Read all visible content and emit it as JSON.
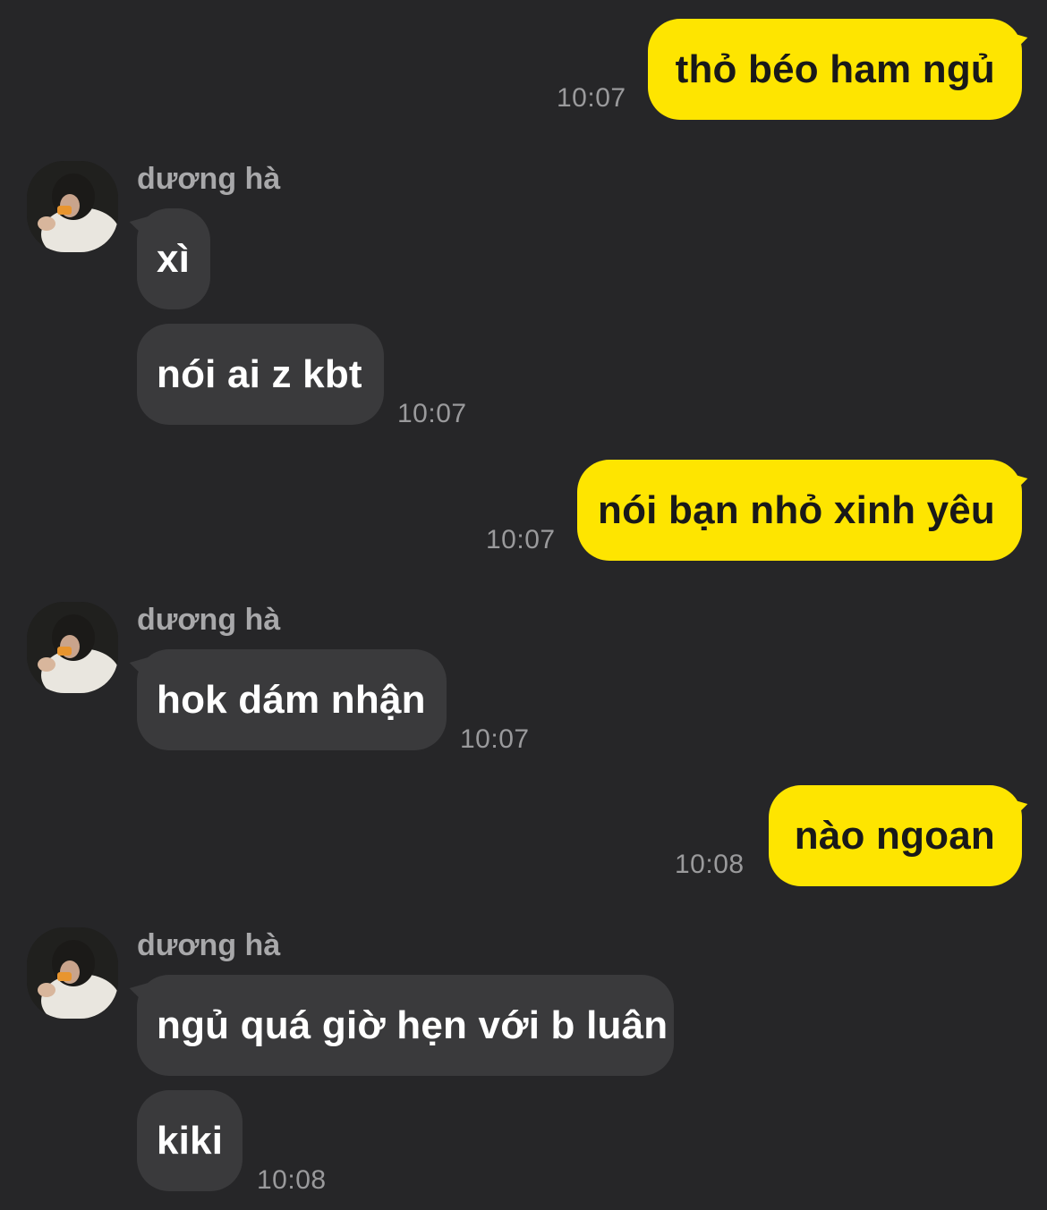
{
  "chat": {
    "contact_name": "dương hà",
    "messages": [
      {
        "dir": "out",
        "text": "thỏ béo ham ngủ",
        "time": "10:07"
      },
      {
        "dir": "in",
        "text": "xì"
      },
      {
        "dir": "in",
        "text": "nói ai z kbt",
        "time": "10:07"
      },
      {
        "dir": "out",
        "text": "nói bạn nhỏ xinh yêu",
        "time": "10:07"
      },
      {
        "dir": "in",
        "text": "hok dám nhận",
        "time": "10:07"
      },
      {
        "dir": "out",
        "text": "nào ngoan",
        "time": "10:08"
      },
      {
        "dir": "in",
        "text": "ngủ quá giờ hẹn với b luân"
      },
      {
        "dir": "in",
        "text": "kiki",
        "time": "10:08"
      }
    ]
  },
  "colors": {
    "background": "#262628",
    "outgoing_bubble": "#FEE500",
    "incoming_bubble": "#3A3A3C",
    "timestamp": "#9A9A9C"
  },
  "icons": {
    "avatar": "contact-avatar-photo"
  }
}
